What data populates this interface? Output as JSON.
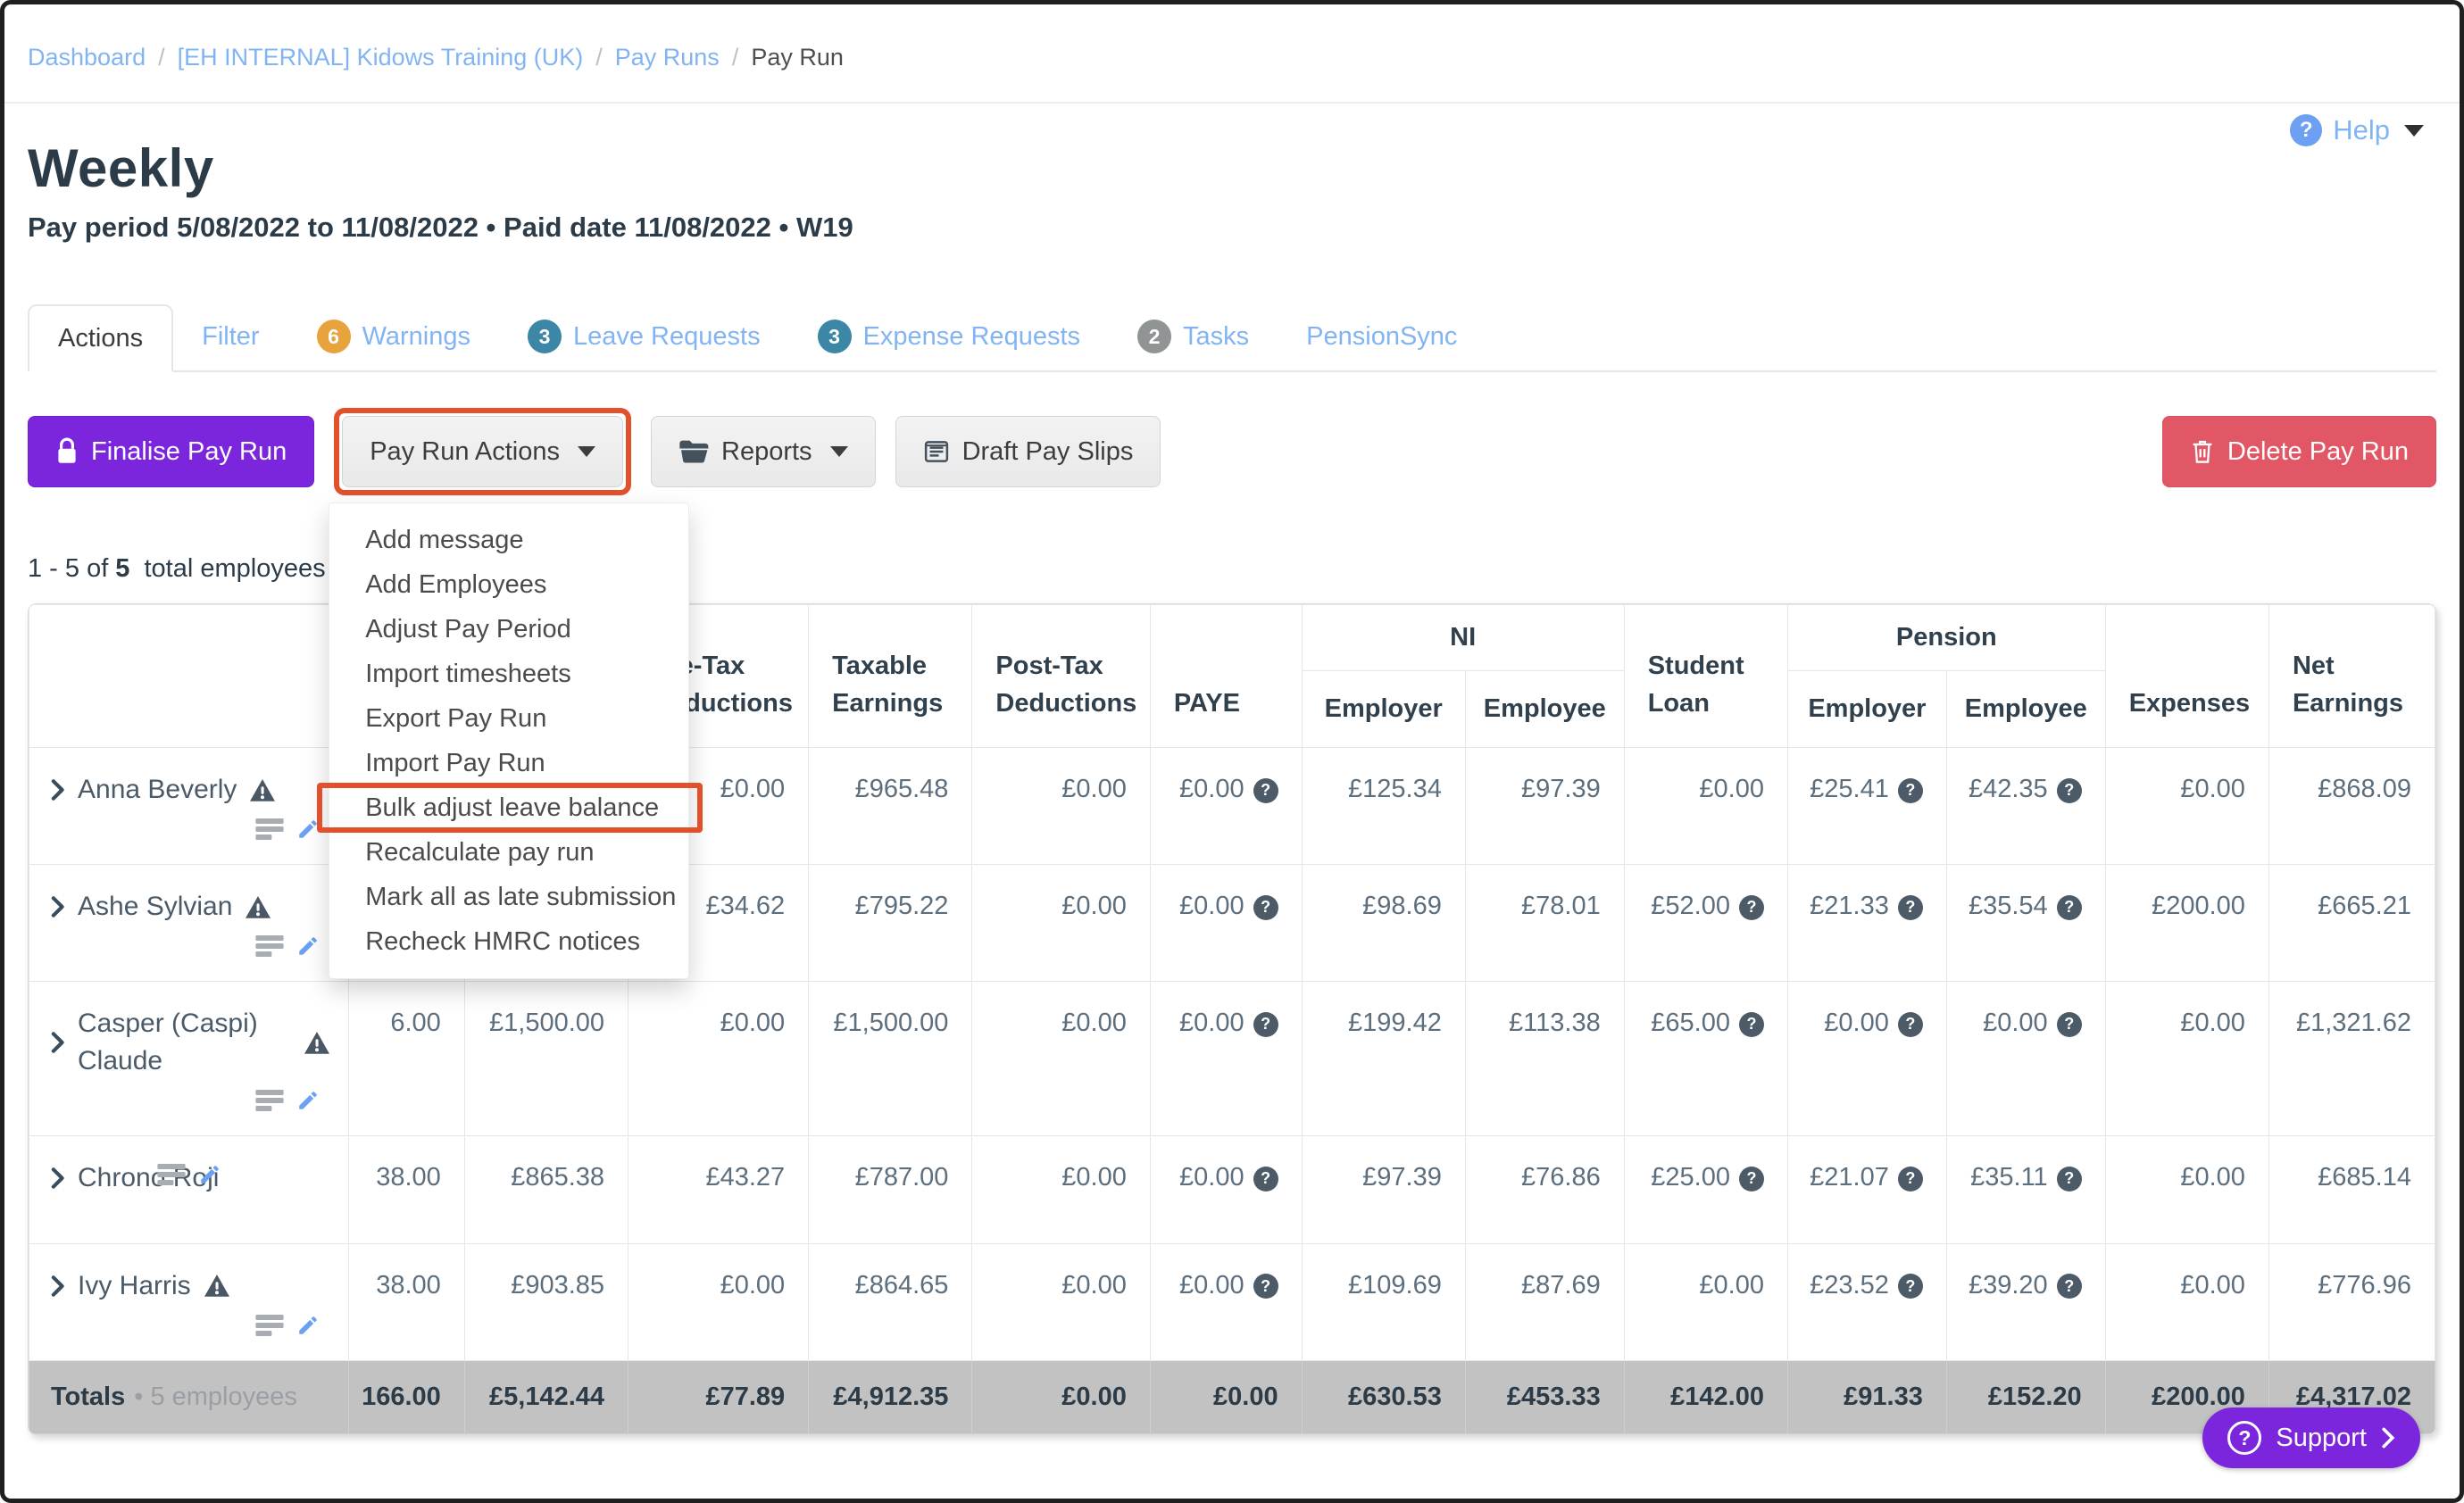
{
  "breadcrumb": {
    "items": [
      "Dashboard",
      "[EH INTERNAL] Kidows Training (UK)",
      "Pay Runs"
    ],
    "current": "Pay Run",
    "separator": "/"
  },
  "header": {
    "title": "Weekly",
    "subtitle": "Pay period 5/08/2022 to 11/08/2022 • Paid date 11/08/2022 • W19",
    "help_label": "Help"
  },
  "tabs": [
    {
      "label": "Actions",
      "active": true
    },
    {
      "label": "Filter"
    },
    {
      "label": "Warnings",
      "badge": "6",
      "badge_color": "#e7a43c"
    },
    {
      "label": "Leave Requests",
      "badge": "3",
      "badge_color": "#3c86a6"
    },
    {
      "label": "Expense Requests",
      "badge": "3",
      "badge_color": "#3c86a6"
    },
    {
      "label": "Tasks",
      "badge": "2",
      "badge_color": "#909495"
    },
    {
      "label": "PensionSync"
    }
  ],
  "toolbar": {
    "finalise_label": "Finalise Pay Run",
    "pay_run_actions_label": "Pay Run Actions",
    "reports_label": "Reports",
    "draft_pay_slips_label": "Draft Pay Slips",
    "delete_label": "Delete Pay Run"
  },
  "menu": {
    "items": [
      "Add message",
      "Add Employees",
      "Adjust Pay Period",
      "Import timesheets",
      "Export Pay Run",
      "Import Pay Run",
      "Bulk adjust leave balance",
      "Recalculate pay run",
      "Mark all as late submission",
      "Recheck HMRC notices"
    ],
    "highlighted": "Bulk adjust leave balance"
  },
  "summary": {
    "prefix": "1 - 5 of",
    "count": "5",
    "suffix": "total employees"
  },
  "table": {
    "groups": {
      "ni": "NI",
      "pension": "Pension"
    },
    "headers": {
      "pre_tax": "Pre-Tax Deductions",
      "taxable": "Taxable Earnings",
      "post_tax": "Post-Tax Deductions",
      "paye": "PAYE",
      "employer": "Employer",
      "employee": "Employee",
      "student_loan": "Student Loan",
      "expenses": "Expenses",
      "net": "Net Earnings"
    },
    "rows": [
      {
        "name": "Anna Beverly",
        "warning": true,
        "icons_inline": false,
        "cells": [
          {
            "v": ""
          },
          {
            "v": ""
          },
          {
            "v": "£0.00"
          },
          {
            "v": "£965.48"
          },
          {
            "v": "£0.00"
          },
          {
            "v": "£0.00",
            "q": true
          },
          {
            "v": "£125.34"
          },
          {
            "v": "£97.39"
          },
          {
            "v": "£0.00"
          },
          {
            "v": "£25.41",
            "q": true
          },
          {
            "v": "£42.35",
            "q": true
          },
          {
            "v": "£0.00"
          },
          {
            "v": "£868.09"
          }
        ]
      },
      {
        "name": "Ashe Sylvian",
        "warning": true,
        "icons_inline": false,
        "cells": [
          {
            "v": ""
          },
          {
            "v": ""
          },
          {
            "v": "£34.62"
          },
          {
            "v": "£795.22"
          },
          {
            "v": "£0.00"
          },
          {
            "v": "£0.00",
            "q": true
          },
          {
            "v": "£98.69"
          },
          {
            "v": "£78.01"
          },
          {
            "v": "£52.00",
            "q": true
          },
          {
            "v": "£21.33",
            "q": true
          },
          {
            "v": "£35.54",
            "q": true
          },
          {
            "v": "£200.00"
          },
          {
            "v": "£665.21"
          }
        ]
      },
      {
        "name": "Casper (Caspi) Claude",
        "warning": true,
        "icons_inline": false,
        "cells": [
          {
            "v": "6.00"
          },
          {
            "v": "£1,500.00"
          },
          {
            "v": "£0.00"
          },
          {
            "v": "£1,500.00"
          },
          {
            "v": "£0.00"
          },
          {
            "v": "£0.00",
            "q": true
          },
          {
            "v": "£199.42"
          },
          {
            "v": "£113.38"
          },
          {
            "v": "£65.00",
            "q": true
          },
          {
            "v": "£0.00",
            "q": true
          },
          {
            "v": "£0.00",
            "q": true
          },
          {
            "v": "£0.00"
          },
          {
            "v": "£1,321.62"
          }
        ]
      },
      {
        "name": "Chrono Roji",
        "warning": false,
        "icons_inline": true,
        "cells": [
          {
            "v": "38.00"
          },
          {
            "v": "£865.38"
          },
          {
            "v": "£43.27"
          },
          {
            "v": "£787.00"
          },
          {
            "v": "£0.00"
          },
          {
            "v": "£0.00",
            "q": true
          },
          {
            "v": "£97.39"
          },
          {
            "v": "£76.86"
          },
          {
            "v": "£25.00",
            "q": true
          },
          {
            "v": "£21.07",
            "q": true
          },
          {
            "v": "£35.11",
            "q": true
          },
          {
            "v": "£0.00"
          },
          {
            "v": "£685.14"
          }
        ]
      },
      {
        "name": "Ivy Harris",
        "warning": true,
        "icons_inline": false,
        "cells": [
          {
            "v": "38.00"
          },
          {
            "v": "£903.85"
          },
          {
            "v": "£0.00"
          },
          {
            "v": "£864.65"
          },
          {
            "v": "£0.00"
          },
          {
            "v": "£0.00",
            "q": true
          },
          {
            "v": "£109.69"
          },
          {
            "v": "£87.69"
          },
          {
            "v": "£0.00"
          },
          {
            "v": "£23.52",
            "q": true
          },
          {
            "v": "£39.20",
            "q": true
          },
          {
            "v": "£0.00"
          },
          {
            "v": "£776.96"
          }
        ]
      }
    ],
    "totals": {
      "label": "Totals",
      "sub": "• 5 employees",
      "values": [
        "166.00",
        "£5,142.44",
        "£77.89",
        "£4,912.35",
        "£0.00",
        "£0.00",
        "£630.53",
        "£453.33",
        "£142.00",
        "£91.33",
        "£152.20",
        "£200.00",
        "£4,317.02"
      ]
    }
  },
  "support": {
    "label": "Support"
  },
  "colors": {
    "accent_purple": "#7b26dd",
    "danger_red": "#e15766",
    "highlight_orange": "#e2502c",
    "link_blue": "#82b4f4",
    "navy_text": "#2c3b48",
    "totals_gray": "#c2c2c2"
  }
}
